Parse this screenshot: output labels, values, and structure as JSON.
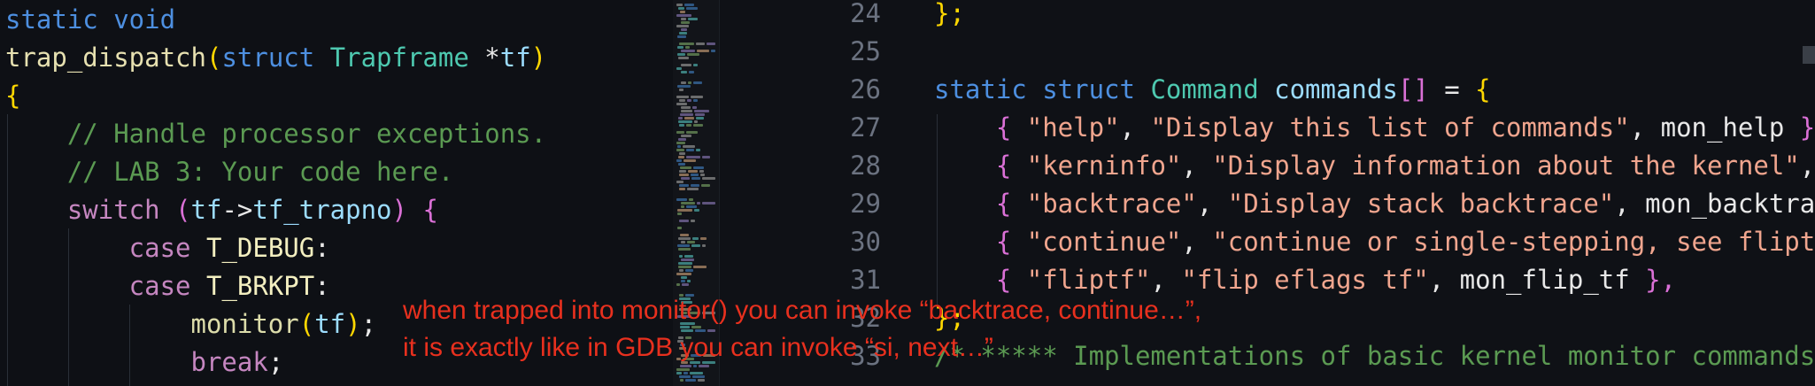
{
  "left_editor": {
    "lines": [
      [
        {
          "t": "static void",
          "c": "kw"
        }
      ],
      [
        {
          "t": "trap_dispatch",
          "c": "fnw"
        },
        {
          "t": "(",
          "c": "br"
        },
        {
          "t": "struct ",
          "c": "kw"
        },
        {
          "t": "Trapframe ",
          "c": "ty"
        },
        {
          "t": "*",
          "c": "pl"
        },
        {
          "t": "tf",
          "c": "var"
        },
        {
          "t": ")",
          "c": "br"
        }
      ],
      [
        {
          "t": "{",
          "c": "br"
        }
      ],
      [
        {
          "t": "    // Handle processor exceptions.",
          "c": "cm"
        }
      ],
      [
        {
          "t": "    // LAB 3: Your code here.",
          "c": "cm"
        }
      ],
      [
        {
          "t": "    switch ",
          "c": "ctl"
        },
        {
          "t": "(",
          "c": "br2"
        },
        {
          "t": "tf",
          "c": "var"
        },
        {
          "t": "->",
          "c": "pl"
        },
        {
          "t": "tf_trapno",
          "c": "var"
        },
        {
          "t": ")",
          "c": "br2"
        },
        {
          "t": " {",
          "c": "br2"
        }
      ],
      [
        {
          "t": "        case ",
          "c": "ctl"
        },
        {
          "t": "T_DEBUG",
          "c": "mac"
        },
        {
          "t": ":",
          "c": "pl"
        }
      ],
      [
        {
          "t": "        case ",
          "c": "ctl"
        },
        {
          "t": "T_BRKPT",
          "c": "mac"
        },
        {
          "t": ":",
          "c": "pl"
        }
      ],
      [
        {
          "t": "            monitor",
          "c": "fn"
        },
        {
          "t": "(",
          "c": "br"
        },
        {
          "t": "tf",
          "c": "var"
        },
        {
          "t": ")",
          "c": "br"
        },
        {
          "t": ";",
          "c": "pl"
        }
      ],
      [
        {
          "t": "            break",
          "c": "ctl"
        },
        {
          "t": ";",
          "c": "pl"
        }
      ]
    ]
  },
  "right_editor": {
    "line_numbers": [
      "24",
      "25",
      "26",
      "27",
      "28",
      "29",
      "30",
      "31",
      "32",
      "33"
    ],
    "lines": [
      [
        {
          "t": "};",
          "c": "br"
        }
      ],
      [],
      [
        {
          "t": "static struct ",
          "c": "kw"
        },
        {
          "t": "Command ",
          "c": "ty"
        },
        {
          "t": "commands",
          "c": "var"
        },
        {
          "t": "[]",
          "c": "br2"
        },
        {
          "t": " = ",
          "c": "pl"
        },
        {
          "t": "{",
          "c": "br"
        }
      ],
      [
        {
          "t": "    { ",
          "c": "br2"
        },
        {
          "t": "\"help\"",
          "c": "str"
        },
        {
          "t": ", ",
          "c": "pl"
        },
        {
          "t": "\"Display this list of commands\"",
          "c": "str"
        },
        {
          "t": ", mon_help ",
          "c": "pl"
        },
        {
          "t": "},",
          "c": "br2"
        }
      ],
      [
        {
          "t": "    { ",
          "c": "br2"
        },
        {
          "t": "\"kerninfo\"",
          "c": "str"
        },
        {
          "t": ", ",
          "c": "pl"
        },
        {
          "t": "\"Display information about the kernel\"",
          "c": "str"
        },
        {
          "t": ",",
          "c": "pl"
        }
      ],
      [
        {
          "t": "    { ",
          "c": "br2"
        },
        {
          "t": "\"backtrace\"",
          "c": "str"
        },
        {
          "t": ", ",
          "c": "pl"
        },
        {
          "t": "\"Display stack backtrace\"",
          "c": "str"
        },
        {
          "t": ", mon_backtrace",
          "c": "pl"
        }
      ],
      [
        {
          "t": "    { ",
          "c": "br2"
        },
        {
          "t": "\"continue\"",
          "c": "str"
        },
        {
          "t": ", ",
          "c": "pl"
        },
        {
          "t": "\"continue or single-stepping, see fliptf\"",
          "c": "str"
        }
      ],
      [
        {
          "t": "    { ",
          "c": "br2"
        },
        {
          "t": "\"fliptf\"",
          "c": "str"
        },
        {
          "t": ", ",
          "c": "pl"
        },
        {
          "t": "\"flip eflags tf\"",
          "c": "str"
        },
        {
          "t": ", mon_flip_tf ",
          "c": "pl"
        },
        {
          "t": "},",
          "c": "br2"
        }
      ],
      [
        {
          "t": "};",
          "c": "br"
        }
      ],
      [
        {
          "t": "/* ***** Implementations of basic kernel monitor commands",
          "c": "cm"
        }
      ]
    ]
  },
  "annotation": {
    "line1": "when trapped into monitor() you can invoke “backtrace, continue…”,",
    "line2": "it is exactly like in GDB you can invoke “si, next…”"
  }
}
